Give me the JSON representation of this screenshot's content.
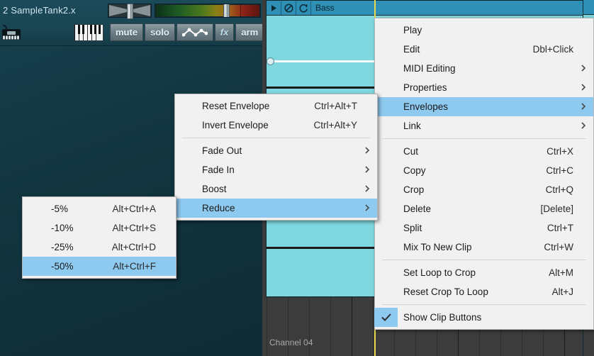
{
  "app": {
    "track": {
      "name": "2 SampleTank2.x",
      "instrument_icon": "synth-keyboard-icon",
      "pan_slider": "pan-slider",
      "level_meter": "level-meter",
      "buttons": [
        {
          "id": "midi-keyboard",
          "label": "",
          "icon": "piano-keys-icon"
        },
        {
          "id": "mute",
          "label": "mute",
          "icon": ""
        },
        {
          "id": "solo",
          "label": "solo",
          "icon": ""
        },
        {
          "id": "envelope",
          "label": "",
          "icon": "envelope-curve-icon"
        },
        {
          "id": "fx",
          "label": "fx",
          "icon": ""
        },
        {
          "id": "arm",
          "label": "arm",
          "icon": ""
        },
        {
          "id": "more",
          "label": "",
          "icon": "chevron-down-icon"
        }
      ]
    },
    "clip": {
      "title": "Bass",
      "header_buttons": [
        "play-icon",
        "mute-circle-slash-icon",
        "loop-icon"
      ],
      "color": "#7fd8e0",
      "header_color": "#2f8fb5"
    },
    "lane": {
      "channel_label": "Channel 04",
      "background": "#3c3c3c"
    }
  },
  "menus": {
    "main": {
      "name": "clip-context-menu",
      "items": [
        {
          "label": "Play",
          "accel": "",
          "arrow": false,
          "highlighted": false,
          "separator_after": false
        },
        {
          "label": "Edit",
          "accel": "Dbl+Click",
          "arrow": false,
          "highlighted": false,
          "separator_after": false
        },
        {
          "label": "MIDI Editing",
          "accel": "",
          "arrow": true,
          "highlighted": false,
          "separator_after": false
        },
        {
          "label": "Properties",
          "accel": "",
          "arrow": true,
          "highlighted": false,
          "separator_after": false
        },
        {
          "label": "Envelopes",
          "accel": "",
          "arrow": true,
          "highlighted": true,
          "separator_after": false
        },
        {
          "label": "Link",
          "accel": "",
          "arrow": true,
          "highlighted": false,
          "separator_after": true
        },
        {
          "label": "Cut",
          "accel": "Ctrl+X",
          "arrow": false,
          "highlighted": false,
          "separator_after": false
        },
        {
          "label": "Copy",
          "accel": "Ctrl+C",
          "arrow": false,
          "highlighted": false,
          "separator_after": false
        },
        {
          "label": "Crop",
          "accel": "Ctrl+Q",
          "arrow": false,
          "highlighted": false,
          "separator_after": false
        },
        {
          "label": "Delete",
          "accel": "[Delete]",
          "arrow": false,
          "highlighted": false,
          "separator_after": false
        },
        {
          "label": "Split",
          "accel": "Ctrl+T",
          "arrow": false,
          "highlighted": false,
          "separator_after": false
        },
        {
          "label": "Mix To New Clip",
          "accel": "Ctrl+W",
          "arrow": false,
          "highlighted": false,
          "separator_after": true
        },
        {
          "label": "Set Loop to Crop",
          "accel": "Alt+M",
          "arrow": false,
          "highlighted": false,
          "separator_after": false
        },
        {
          "label": "Reset Crop To Loop",
          "accel": "Alt+J",
          "arrow": false,
          "highlighted": false,
          "separator_after": true
        },
        {
          "label": "Show Clip Buttons",
          "accel": "",
          "arrow": false,
          "highlighted": false,
          "separator_after": false,
          "checked": true
        }
      ]
    },
    "envelopes": {
      "name": "envelopes-submenu",
      "items": [
        {
          "label": "Reset Envelope",
          "accel": "Ctrl+Alt+T",
          "arrow": false,
          "highlighted": false,
          "separator_after": false
        },
        {
          "label": "Invert Envelope",
          "accel": "Ctrl+Alt+Y",
          "arrow": false,
          "highlighted": false,
          "separator_after": true
        },
        {
          "label": "Fade Out",
          "accel": "",
          "arrow": true,
          "highlighted": false,
          "separator_after": false
        },
        {
          "label": "Fade In",
          "accel": "",
          "arrow": true,
          "highlighted": false,
          "separator_after": false
        },
        {
          "label": "Boost",
          "accel": "",
          "arrow": true,
          "highlighted": false,
          "separator_after": false
        },
        {
          "label": "Reduce",
          "accel": "",
          "arrow": true,
          "highlighted": true,
          "separator_after": false
        }
      ]
    },
    "reduce": {
      "name": "reduce-submenu",
      "items": [
        {
          "label": "-5%",
          "accel": "Alt+Ctrl+A",
          "arrow": false,
          "highlighted": false,
          "separator_after": false
        },
        {
          "label": "-10%",
          "accel": "Alt+Ctrl+S",
          "arrow": false,
          "highlighted": false,
          "separator_after": false
        },
        {
          "label": "-25%",
          "accel": "Alt+Ctrl+D",
          "arrow": false,
          "highlighted": false,
          "separator_after": false
        },
        {
          "label": "-50%",
          "accel": "Alt+Ctrl+F",
          "arrow": false,
          "highlighted": true,
          "separator_after": false
        }
      ]
    }
  },
  "colors": {
    "menu_bg": "#f1f1f1",
    "menu_highlight": "#8ec9f0",
    "clip": "#7fd8e0",
    "clip_header": "#2f8fb5",
    "track_bg": "#1a4653",
    "lane_bg": "#3c3c3c",
    "playhead": "#e8d84a"
  }
}
